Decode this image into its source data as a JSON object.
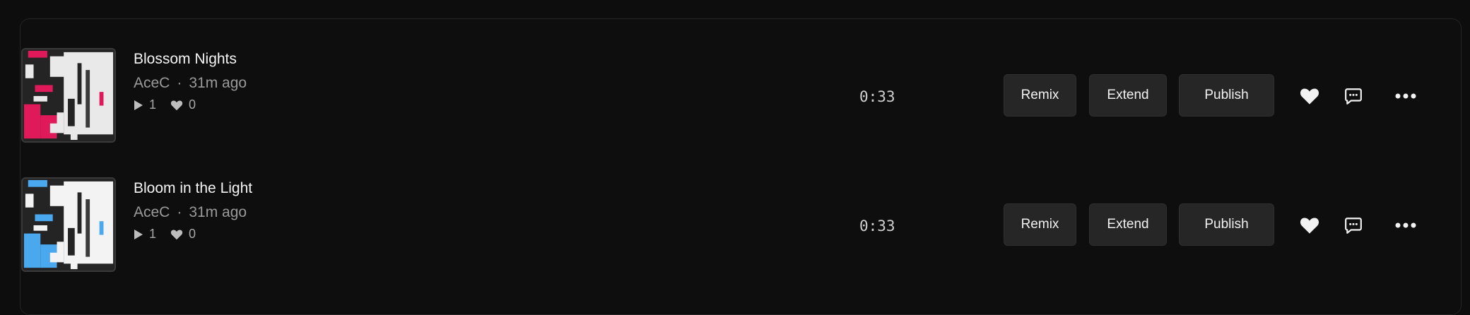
{
  "tracks": [
    {
      "title": "Blossom Nights",
      "artist": "AceC",
      "separator": "·",
      "time_ago": "31m ago",
      "plays": "1",
      "likes": "0",
      "duration": "0:33",
      "accent_color": "#e0195a",
      "buttons": {
        "remix": "Remix",
        "extend": "Extend",
        "publish": "Publish"
      }
    },
    {
      "title": "Bloom in the Light",
      "artist": "AceC",
      "separator": "·",
      "time_ago": "31m ago",
      "plays": "1",
      "likes": "0",
      "duration": "0:33",
      "accent_color": "#4aa8ef",
      "buttons": {
        "remix": "Remix",
        "extend": "Extend",
        "publish": "Publish"
      }
    }
  ],
  "icons": {
    "play": "play-icon",
    "heart": "heart-icon",
    "comment": "comment-icon",
    "more": "more-icon"
  }
}
